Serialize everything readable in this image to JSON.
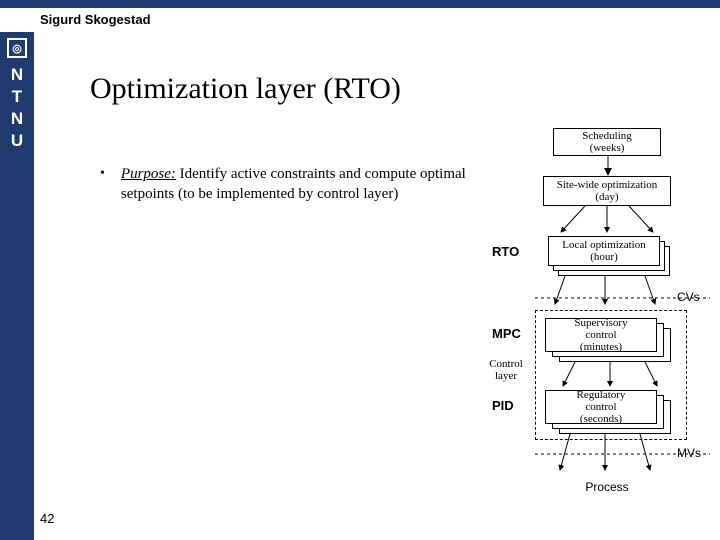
{
  "author": "Sigurd Skogestad",
  "slide_title": "Optimization layer (RTO)",
  "bullet": {
    "lead": "Purpose:",
    "text": " Identify active constraints and compute optimal setpoints (to be implemented by control layer)"
  },
  "slide_number": "42",
  "ntnu_letters": [
    "N",
    "T",
    "N",
    "U"
  ],
  "hierarchy": {
    "scheduling": "Scheduling\n(weeks)",
    "sitewide": "Site-wide optimization\n(day)",
    "local": "Local optimization\n(hour)",
    "supervisory": "Supervisory\ncontrol\n(minutes)",
    "regulatory": "Regulatory\ncontrol\n(seconds)",
    "control_layer": "Control\nlayer",
    "cvs": "CVs",
    "mvs": "MVs",
    "process": "Process"
  },
  "tags": {
    "rto": "RTO",
    "mpc": "MPC",
    "pid": "PID"
  }
}
